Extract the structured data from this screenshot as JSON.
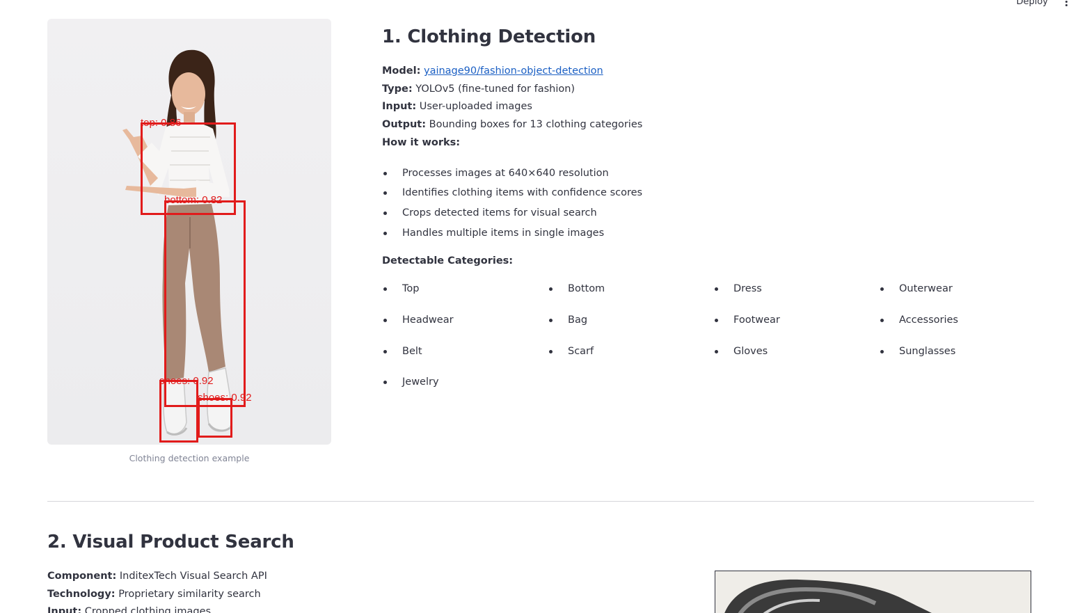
{
  "toolbar": {
    "deploy_label": "Deploy"
  },
  "section1": {
    "title": "1. Clothing Detection",
    "image_caption": "Clothing detection example",
    "detections": [
      {
        "label": "top: 0.86"
      },
      {
        "label": "bottom: 0.82"
      },
      {
        "label": "shoes: 0.92"
      },
      {
        "label": "shoes: 0.92"
      }
    ],
    "model_label": "Model:",
    "model_link": "yainage90/fashion-object-detection",
    "type_label": "Type:",
    "type_value": "YOLOv5 (fine-tuned for fashion)",
    "input_label": "Input:",
    "input_value": "User-uploaded images",
    "output_label": "Output:",
    "output_value": "Bounding boxes for 13 clothing categories",
    "how_label": "How it works:",
    "how_items": [
      "Processes images at 640×640 resolution",
      "Identifies clothing items with confidence scores",
      "Crops detected items for visual search",
      "Handles multiple items in single images"
    ],
    "categories_label": "Detectable Categories:",
    "categories": [
      "Top",
      "Bottom",
      "Dress",
      "Outerwear",
      "Headwear",
      "Bag",
      "Footwear",
      "Accessories",
      "Belt",
      "Scarf",
      "Gloves",
      "Sunglasses",
      "Jewelry"
    ]
  },
  "section2": {
    "title": "2. Visual Product Search",
    "component_label": "Component:",
    "component_value": "InditexTech Visual Search API",
    "technology_label": "Technology:",
    "technology_value": "Proprietary similarity search",
    "input_label": "Input:",
    "input_value": "Cropped clothing images"
  },
  "colors": {
    "detection": "#e11b1b",
    "link": "#1c60c4",
    "text": "#31333f"
  }
}
